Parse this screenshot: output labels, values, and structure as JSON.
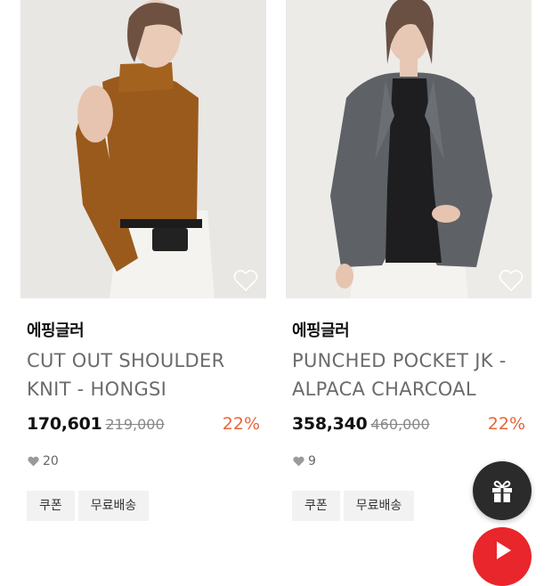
{
  "products": [
    {
      "brand": "에핑글러",
      "title": "CUT OUT SHOULDER KNIT - HONGSI",
      "price": "170,601",
      "original_price": "219,000",
      "discount": "22%",
      "likes": "20",
      "tags": [
        "쿠폰",
        "무료배송"
      ],
      "image_icon": "model-brown-knit-photo"
    },
    {
      "brand": "에핑글러",
      "title": "PUNCHED POCKET JK - ALPACA CHARCOAL",
      "price": "358,340",
      "original_price": "460,000",
      "discount": "22%",
      "likes": "9",
      "tags": [
        "쿠폰",
        "무료배송"
      ],
      "image_icon": "model-charcoal-jacket-photo"
    }
  ],
  "floating": {
    "gift_icon": "gift-icon",
    "play_icon": "play-icon"
  },
  "colors": {
    "discount": "#e5663a",
    "fab_dark": "#2b2b2b",
    "fab_red": "#e8262b"
  }
}
